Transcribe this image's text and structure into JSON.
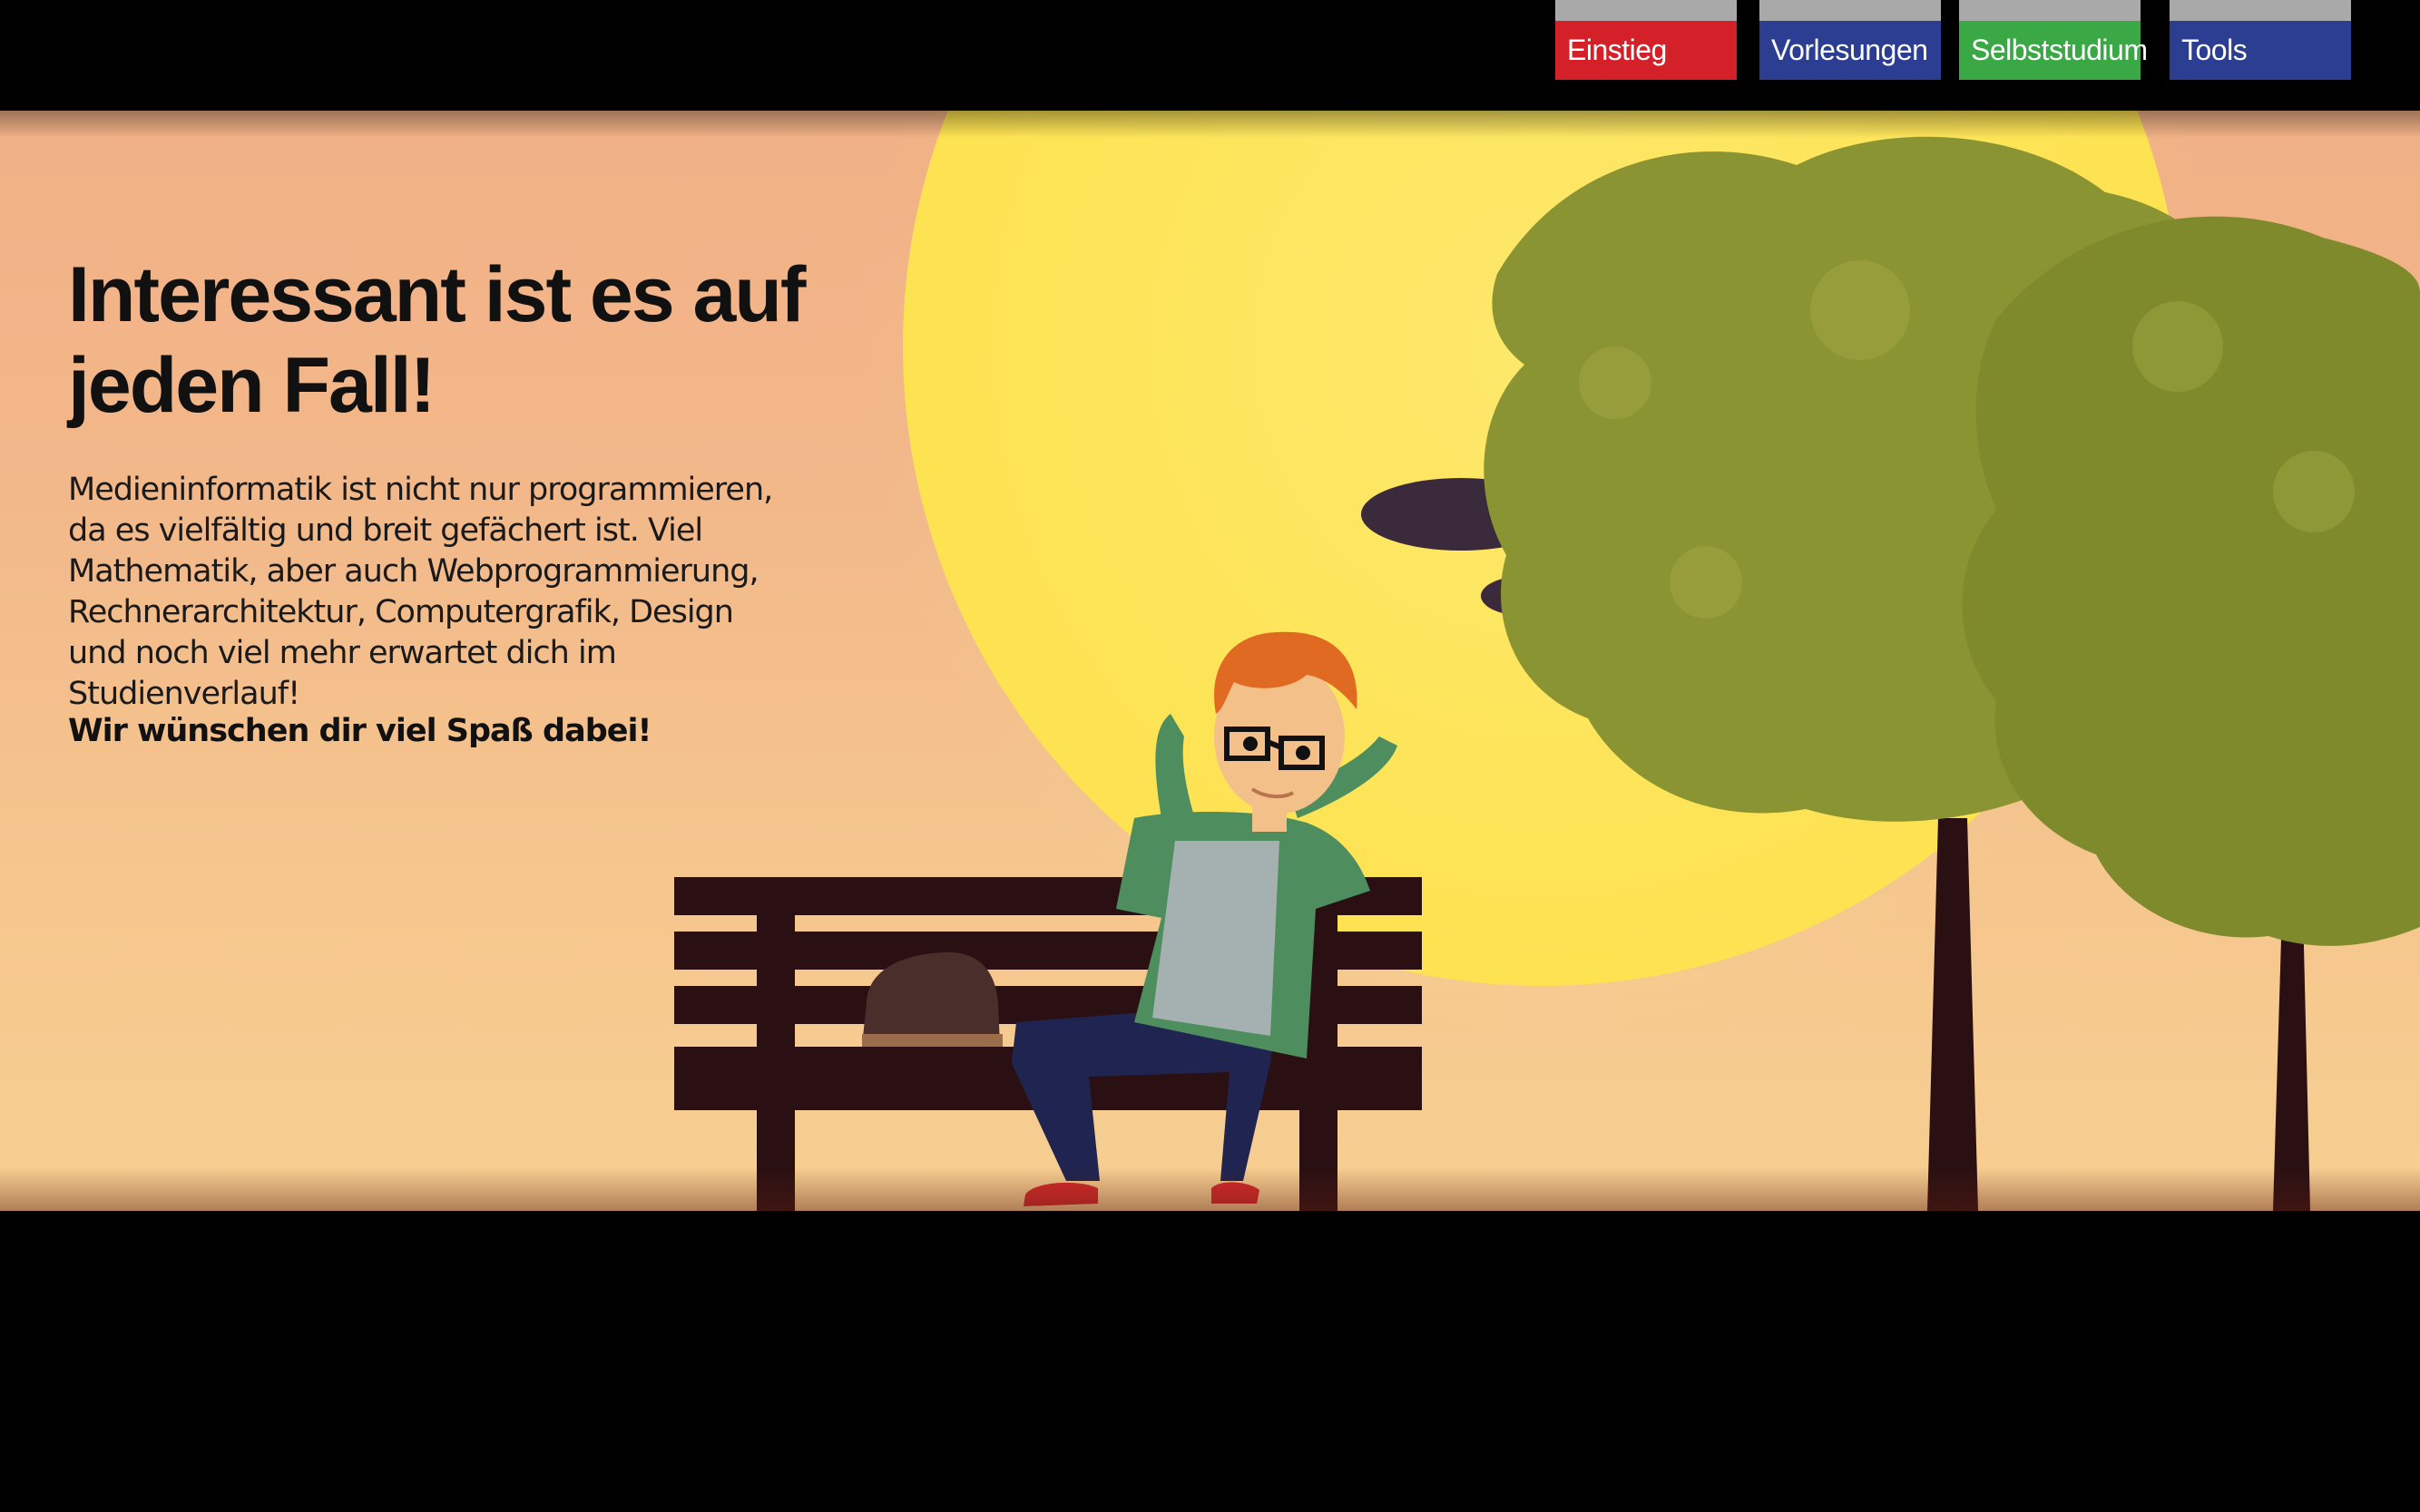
{
  "nav": {
    "tabs": [
      {
        "label": "Einstieg",
        "color": "#d42129"
      },
      {
        "label": "Vorlesungen",
        "color": "#2b3e92"
      },
      {
        "label": "Selbststudium",
        "color": "#39a845"
      },
      {
        "label": "Tools",
        "color": "#2b3e92"
      }
    ],
    "tab_cap_color": "#a9a9a9"
  },
  "hero": {
    "headline": "Interessant ist es auf jeden Fall!",
    "intro": "Medieninformatik ist nicht nur programmieren, da es vielfältig und breit gefächert ist. Viel Mathe­matik, aber auch Webprogrammierung, Rechner­architektur, Computergrafik, Design und noch viel mehr  erwartet dich im Studienverlauf!",
    "closing": "Wir wünschen dir viel Spaß dabei!",
    "illustration": {
      "sun_color": "#fde24f",
      "tree_color": "#8a9433",
      "bench_color": "#2a1012",
      "trunk_color": "#2a1012"
    }
  }
}
